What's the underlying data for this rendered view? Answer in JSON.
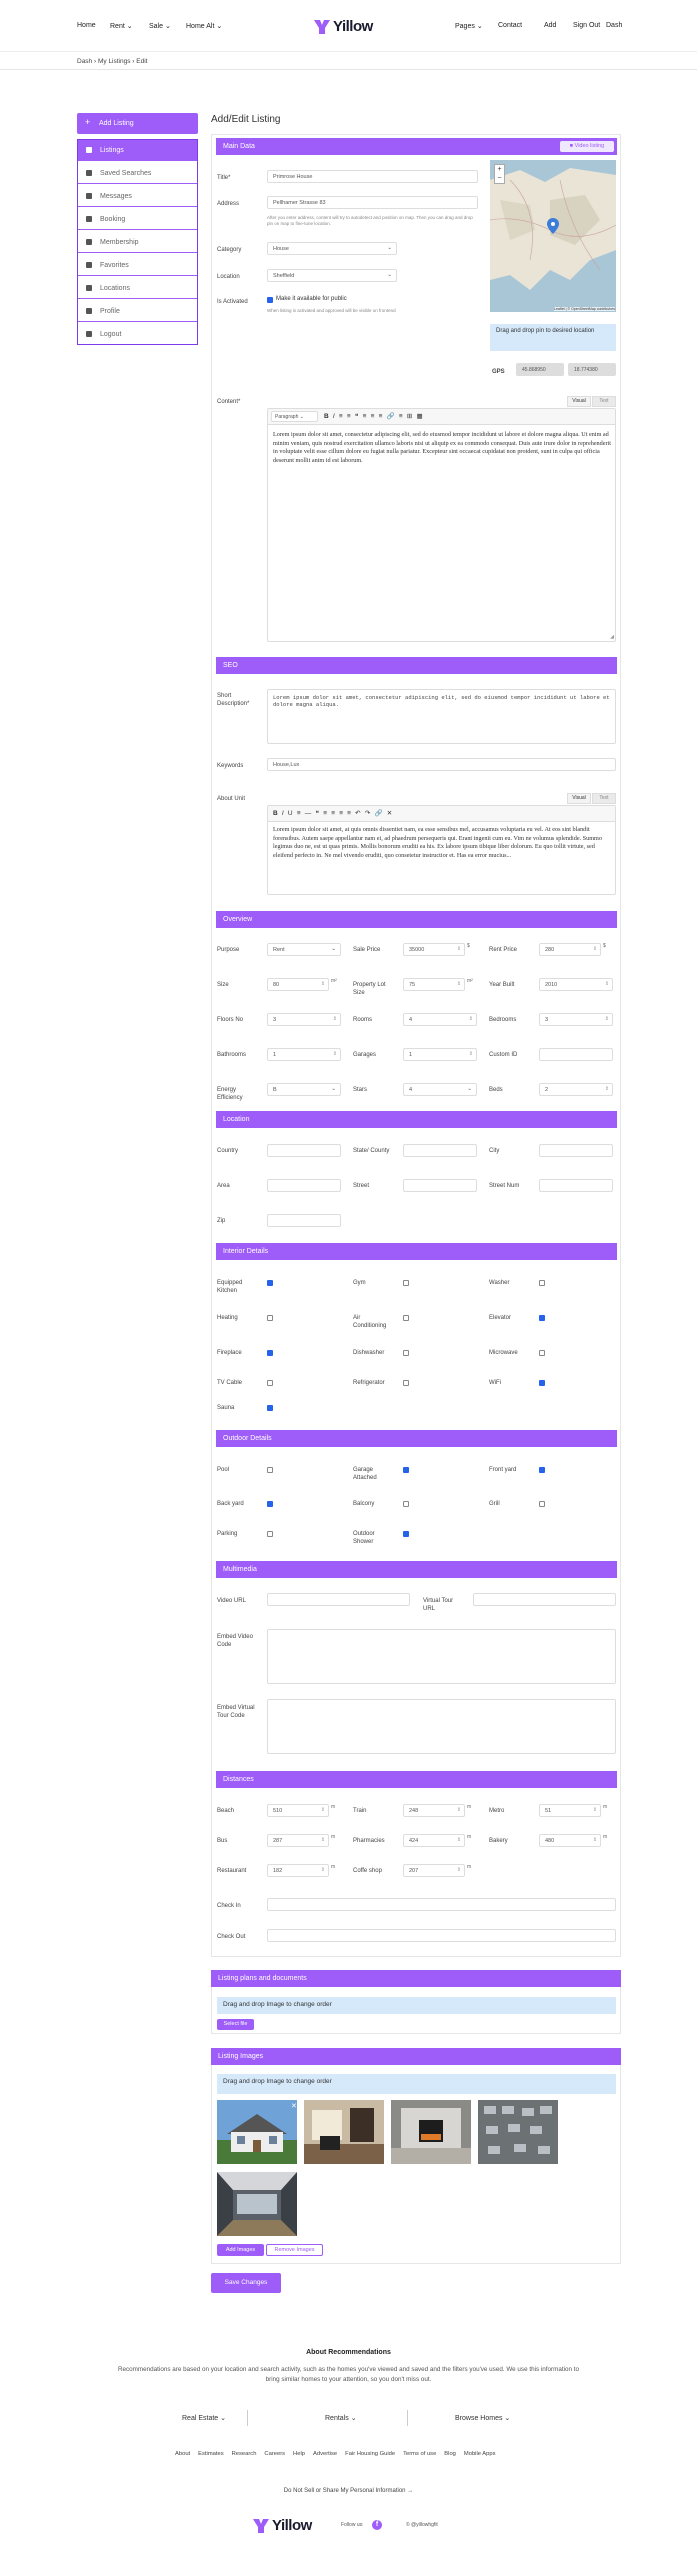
{
  "header": {
    "nav_left": [
      "Home",
      "Rent",
      "Sale",
      "Home Alt"
    ],
    "logo_text": "Yillow",
    "nav_right": [
      "Pages",
      "Contact",
      "Add",
      "Sign Out",
      "Dash"
    ]
  },
  "breadcrumb": [
    "Dash",
    "My Listings",
    "Edit"
  ],
  "sidebar": {
    "add_label": "Add Listing",
    "items": [
      "Listings",
      "Saved Searches",
      "Messages",
      "Booking",
      "Membership",
      "Favorites",
      "Locations",
      "Profile",
      "Logout"
    ]
  },
  "page_title": "Add/Edit Listing",
  "main_data": {
    "section": "Main Data",
    "video_btn": "Video listing",
    "title_label": "Title*",
    "title_value": "Primrose House",
    "address_label": "Address",
    "address_value": "Pellhamer Strasse 83",
    "address_hint": "After you enter address, content will try to autodetect and position on map. Then you can drag and drop pin on map to fine-tune location.",
    "category_label": "Category",
    "category_value": "House",
    "location_label": "Location",
    "location_value": "Sheffield",
    "activated_label": "Is Activated",
    "activated_check": "Make it available for public",
    "activated_hint": "When listing is activated and approved will be visible on frontend",
    "map_info": "Drag and drop pin to desired location",
    "gps_label": "GPS",
    "gps_lat": "45.868950",
    "gps_lng": "18.774380",
    "map_attr": "Leaflet | © OpenStreetMap contributors",
    "content_label": "Content*",
    "visual_tab": "Visual",
    "text_tab": "Text",
    "paragraph": "Paragraph",
    "content_text": "Lorem ipsum dolor sit amet, consectetur adipiscing elit, sed do eiusmod tempor incididunt ut labore et dolore magna aliqua. Ut enim ad minim veniam, quis nostrud exercitation ullamco laboris nisi ut aliquip ex ea commodo consequat. Duis aute irure dolor in reprehenderit in voluptate velit esse cillum dolore eu fugiat nulla pariatur. Excepteur sint occaecat cupidatat non proident, sunt in culpa qui officia deserunt mollit anim id est laborum."
  },
  "seo": {
    "section": "SEO",
    "short_label": "Short Description*",
    "short_value": "Lorem ipsum dolor sit amet, consectetur adipiscing elit, sed do eiusmod tempor incididunt ut labore et dolore magna aliqua.",
    "keywords_label": "Keywords",
    "keywords_value": "House,Lux",
    "about_label": "About Unit",
    "visual_tab": "Visual",
    "text_tab": "Text",
    "about_text": "Lorem ipsum dolor sit amet, at quis omnis dissentiet nam, ea esse sensibus mel, accusamus voluptaria eu vel. At eos sint blandit forensibus. Autem saepe appellantur nam ei, ad phaedrum persequeris qui. Erant ingenii cum eu. Vim ne volumus splendide. Summo legimus duo ne, est ut quas primis. Mollis bonorum eruditi ea his. Ex labore ipsum tibique liber dolorum. Eu quo tollit virtute, sed eleifend perfecto in. Ne mel vivendo eruditi, quo consetetur instructior et. Has ea error mucius..."
  },
  "overview": {
    "section": "Overview",
    "fields": [
      {
        "label": "Purpose",
        "value": "Rent",
        "type": "select"
      },
      {
        "label": "Sale Price",
        "value": "35000",
        "unit": "$",
        "type": "num"
      },
      {
        "label": "Rent Price",
        "value": "280",
        "unit": "$",
        "type": "num"
      },
      {
        "label": "Size",
        "value": "80",
        "unit": "m²",
        "type": "num"
      },
      {
        "label": "Property Lot Size",
        "value": "75",
        "unit": "m²",
        "type": "num"
      },
      {
        "label": "Year Built",
        "value": "2010",
        "type": "num"
      },
      {
        "label": "Floors No",
        "value": "3",
        "type": "num"
      },
      {
        "label": "Rooms",
        "value": "4",
        "type": "num"
      },
      {
        "label": "Bedrooms",
        "value": "3",
        "type": "num"
      },
      {
        "label": "Bathrooms",
        "value": "1",
        "type": "num"
      },
      {
        "label": "Garages",
        "value": "1",
        "type": "num"
      },
      {
        "label": "Custom ID",
        "value": "",
        "type": "text"
      },
      {
        "label": "Energy Efficiency",
        "value": "B",
        "type": "select"
      },
      {
        "label": "Stars",
        "value": "4",
        "type": "select"
      },
      {
        "label": "Beds",
        "value": "2",
        "type": "num"
      }
    ]
  },
  "location": {
    "section": "Location",
    "fields": [
      "Country",
      "State/ County",
      "City",
      "Area",
      "Street",
      "Street Num",
      "Zip"
    ]
  },
  "interior": {
    "section": "Interior Details",
    "items": [
      {
        "label": "Equipped Kitchen",
        "on": true
      },
      {
        "label": "Gym",
        "on": false
      },
      {
        "label": "Washer",
        "on": false
      },
      {
        "label": "Heating",
        "on": false
      },
      {
        "label": "Air Conditioning",
        "on": false
      },
      {
        "label": "Elevator",
        "on": true
      },
      {
        "label": "Fireplace",
        "on": true
      },
      {
        "label": "Dishwasher",
        "on": false
      },
      {
        "label": "Microwave",
        "on": false
      },
      {
        "label": "TV Cable",
        "on": false
      },
      {
        "label": "Refrigerator",
        "on": false
      },
      {
        "label": "WiFi",
        "on": true
      },
      {
        "label": "Sauna",
        "on": true
      }
    ]
  },
  "outdoor": {
    "section": "Outdoor Details",
    "items": [
      {
        "label": "Pool",
        "on": false
      },
      {
        "label": "Garage Attached",
        "on": true
      },
      {
        "label": "Front yard",
        "on": true
      },
      {
        "label": "Back yard",
        "on": true
      },
      {
        "label": "Balcony",
        "on": false
      },
      {
        "label": "Grill",
        "on": false
      },
      {
        "label": "Parking",
        "on": false
      },
      {
        "label": "Outdoor Shower",
        "on": true
      }
    ]
  },
  "multimedia": {
    "section": "Multimedia",
    "video_label": "Video URL",
    "tour_label": "Virtual Tour URL",
    "embed_video_label": "Embed Video Code",
    "embed_tour_label": "Embed Virtual Tour Code"
  },
  "distances": {
    "section": "Distances",
    "fields": [
      {
        "label": "Beach",
        "value": "510",
        "unit": "m"
      },
      {
        "label": "Train",
        "value": "248",
        "unit": "m"
      },
      {
        "label": "Metro",
        "value": "51",
        "unit": "m"
      },
      {
        "label": "Bus",
        "value": "287",
        "unit": "m"
      },
      {
        "label": "Pharmacies",
        "value": "424",
        "unit": "m"
      },
      {
        "label": "Bakery",
        "value": "480",
        "unit": "m"
      },
      {
        "label": "Restaurant",
        "value": "182",
        "unit": "m"
      },
      {
        "label": "Coffe shop",
        "value": "207",
        "unit": "m"
      }
    ],
    "checkin_label": "Check In",
    "checkout_label": "Check Out"
  },
  "plans": {
    "section": "Listing plans and documents",
    "info": "Drag and drop Image to change order",
    "btn": "Select file"
  },
  "images": {
    "section": "Listing Images",
    "info": "Drag and drop Image to change order",
    "add_btn": "Add Images",
    "remove_btn": "Remove Images"
  },
  "save_btn": "Save Changes",
  "footer": {
    "about_title": "About Recommendations",
    "about_text": "Recommendations are based on your location and search activity, such as the homes you've viewed and saved and the filters you've used. We use this information to bring similar homes to your attention, so you don't miss out.",
    "dropdowns": [
      "Real Estate",
      "Rentals",
      "Browse Homes"
    ],
    "links": [
      "About",
      "Estimates",
      "Research",
      "Careers",
      "Help",
      "Advertise",
      "Fair Housing Guide",
      "Terms of use",
      "Blog",
      "Mobile Apps"
    ],
    "dnsmpi": "Do Not Sell or Share My Personal Information →",
    "logo_text": "Yillow",
    "follow": "Follow us:",
    "copyright": "© @yillowhgfit"
  },
  "colors": {
    "accent": "#9e5cf9",
    "info": "#d6e9fb",
    "check": "#2563eb"
  }
}
